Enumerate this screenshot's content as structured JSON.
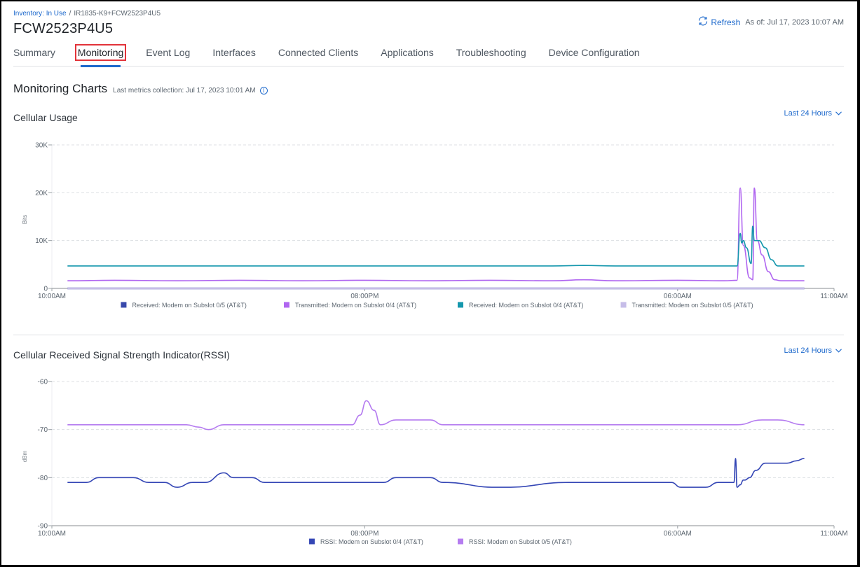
{
  "breadcrumb": {
    "parent": "Inventory: In Use",
    "separator": "/",
    "current": "IR1835-K9+FCW2523P4U5"
  },
  "device_title": "FCW2523P4U5",
  "refresh": {
    "label": "Refresh",
    "icon": "refresh-icon",
    "as_of": "As of: Jul 17, 2023 10:07 AM"
  },
  "tabs": [
    {
      "label": "Summary",
      "active": false
    },
    {
      "label": "Monitoring",
      "active": true
    },
    {
      "label": "Event Log",
      "active": false
    },
    {
      "label": "Interfaces",
      "active": false
    },
    {
      "label": "Connected Clients",
      "active": false
    },
    {
      "label": "Applications",
      "active": false
    },
    {
      "label": "Troubleshooting",
      "active": false
    },
    {
      "label": "Device Configuration",
      "active": false
    }
  ],
  "section": {
    "title": "Monitoring Charts",
    "meta": "Last metrics collection: Jul 17, 2023 10:01 AM",
    "info_icon": "info-icon"
  },
  "colors": {
    "accent": "#1d69cc",
    "highlight_box": "#e2333a"
  },
  "chart_data": [
    {
      "type": "line",
      "title": "Cellular Usage",
      "range_label": "Last 24 Hours",
      "xlabel": "",
      "ylabel": "Bits",
      "ylim": [
        0,
        30000
      ],
      "yticks": [
        0,
        10000,
        20000,
        30000
      ],
      "ytick_labels": [
        "0",
        "10K",
        "20K",
        "30K"
      ],
      "xlim_hours": [
        0,
        25
      ],
      "xticks_hours": [
        0,
        10,
        20,
        25
      ],
      "xtick_labels": [
        "10:00AM",
        "08:00PM",
        "06:00AM",
        "11:00AM"
      ],
      "grid": true,
      "legend": "bottom",
      "series": [
        {
          "name": "Received: Modem on Subslot 0/5 (AT&T)",
          "color": "#3949ab",
          "x": [
            0.5,
            24.05
          ],
          "y": [
            0,
            0
          ]
        },
        {
          "name": "Transmitted: Modem on Subslot 0/4 (AT&T)",
          "color": "#b066f0",
          "x": [
            0.5,
            2,
            4,
            6,
            8,
            10,
            12,
            14,
            16,
            17,
            18,
            20,
            21.5,
            21.9,
            22.0,
            22.1,
            22.3,
            22.4,
            22.45,
            22.55,
            22.7,
            22.9,
            23.1,
            23.3,
            24.05
          ],
          "y": [
            1600,
            1700,
            1600,
            1700,
            1600,
            1700,
            1600,
            1700,
            1600,
            1800,
            1600,
            1700,
            1600,
            1700,
            21000,
            9000,
            2200,
            1800,
            21000,
            10000,
            7000,
            3500,
            1800,
            1600,
            1600
          ]
        },
        {
          "name": "Received: Modem on Subslot 0/4 (AT&T)",
          "color": "#1597ad",
          "x": [
            0.5,
            2,
            4,
            6,
            8,
            10,
            12,
            14,
            16,
            17,
            18,
            20,
            21.5,
            21.9,
            22.0,
            22.05,
            22.1,
            22.2,
            22.35,
            22.4,
            22.45,
            22.6,
            22.8,
            23.0,
            23.2,
            24.05
          ],
          "y": [
            4700,
            4700,
            4700,
            4700,
            4700,
            4700,
            4700,
            4700,
            4700,
            4800,
            4700,
            4700,
            4700,
            4700,
            11500,
            9500,
            10000,
            8500,
            5200,
            13000,
            10000,
            10000,
            8500,
            6000,
            4700,
            4700
          ]
        },
        {
          "name": "Transmitted: Modem on Subslot 0/5 (AT&T)",
          "color": "#c6bde8",
          "x": [
            0.5,
            24.05
          ],
          "y": [
            0,
            0
          ]
        }
      ]
    },
    {
      "type": "line",
      "title": "Cellular Received Signal Strength Indicator(RSSI)",
      "range_label": "Last 24 Hours",
      "xlabel": "",
      "ylabel": "dBm",
      "ylim": [
        -90,
        -60
      ],
      "yticks": [
        -90,
        -80,
        -70,
        -60
      ],
      "ytick_labels": [
        "-90",
        "-80",
        "-70",
        "-60"
      ],
      "xlim_hours": [
        0,
        25
      ],
      "xticks_hours": [
        0,
        10,
        20,
        25
      ],
      "xtick_labels": [
        "10:00AM",
        "08:00PM",
        "06:00AM",
        "11:00AM"
      ],
      "grid": true,
      "legend": "bottom",
      "series": [
        {
          "name": "RSSI: Modem on Subslot 0/4 (AT&T)",
          "color": "#3446b5",
          "x": [
            0.5,
            1.1,
            1.5,
            2.6,
            3.1,
            3.6,
            4.0,
            4.5,
            4.9,
            5.5,
            5.8,
            6.4,
            6.8,
            7.2,
            9.5,
            10.6,
            11.0,
            12.1,
            12.5,
            14.2,
            14.5,
            16.5,
            19.8,
            20.1,
            20.9,
            21.3,
            21.8,
            21.85,
            21.9,
            22.0,
            22.1,
            22.15,
            22.3,
            22.5,
            22.8,
            23.5,
            23.8,
            24.05
          ],
          "y": [
            -81,
            -81,
            -80,
            -80,
            -81,
            -81,
            -82,
            -81,
            -81,
            -79,
            -80,
            -80,
            -81,
            -81,
            -81,
            -81,
            -80,
            -80,
            -81,
            -82,
            -82,
            -81,
            -81,
            -82,
            -82,
            -81,
            -81,
            -76,
            -82,
            -81.5,
            -80.5,
            -80.5,
            -80,
            -78.5,
            -77,
            -77,
            -76.5,
            -76
          ]
        },
        {
          "name": "RSSI: Modem on Subslot 0/5 (AT&T)",
          "color": "#b57cf0",
          "x": [
            0.5,
            4.3,
            4.7,
            5.0,
            5.5,
            9.6,
            9.85,
            10.05,
            10.3,
            10.5,
            11.0,
            12.1,
            12.5,
            21.5,
            21.9,
            22.7,
            23.05,
            23.2,
            24.05
          ],
          "y": [
            -69,
            -69,
            -69.5,
            -70,
            -69,
            -69,
            -67,
            -64,
            -66,
            -69,
            -68,
            -68,
            -69,
            -69,
            -69,
            -68,
            -68,
            -68,
            -69
          ]
        }
      ]
    }
  ]
}
